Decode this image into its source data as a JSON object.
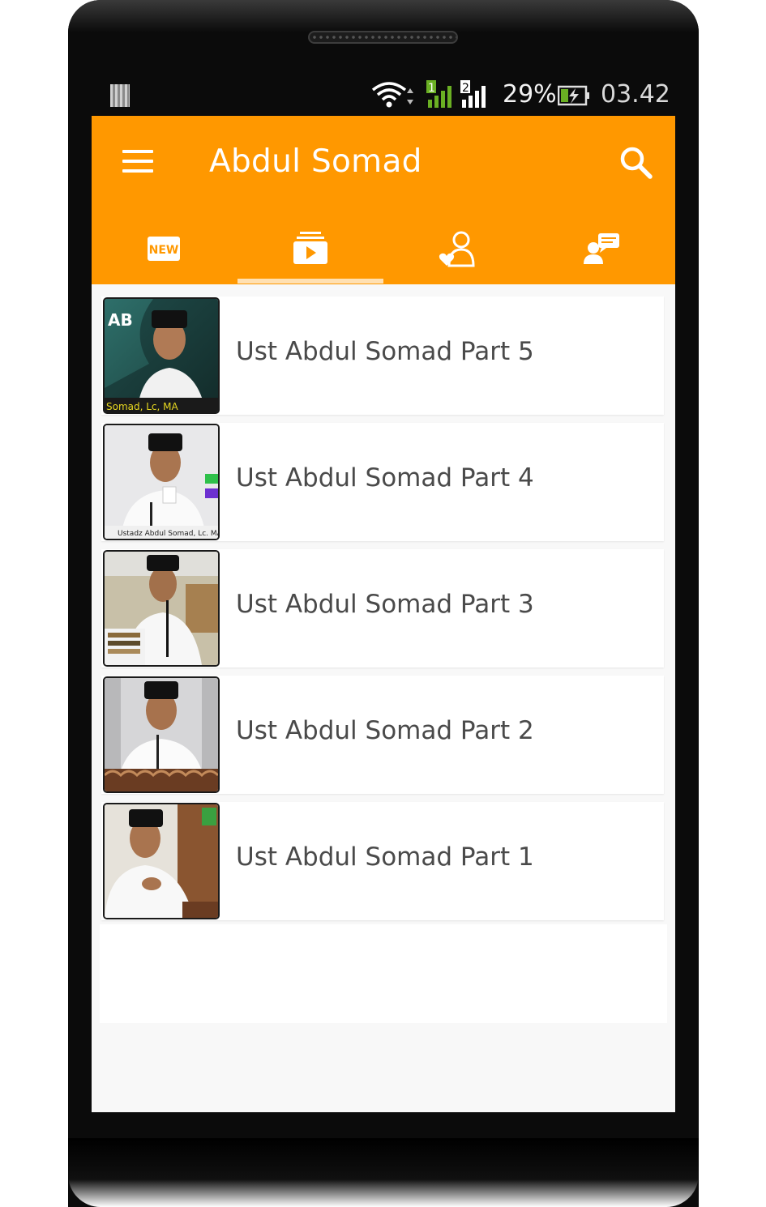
{
  "status_bar": {
    "battery_percent": "29%",
    "time": "03.42",
    "sim1_label": "1",
    "sim2_label": "2",
    "icons": [
      "sd-card-icon",
      "wifi-icon",
      "signal-sim1-icon",
      "signal-sim2-icon",
      "battery-charging-icon"
    ]
  },
  "app_bar": {
    "title": "Abdul Somad",
    "menu_icon": "hamburger-menu-icon",
    "search_icon": "search-icon",
    "background_color": "#ff9800"
  },
  "tabs": [
    {
      "name": "new",
      "icon": "new-badge-icon",
      "label": "NEW",
      "selected": false
    },
    {
      "name": "videos",
      "icon": "video-playlist-icon",
      "selected": true
    },
    {
      "name": "favorites",
      "icon": "user-heart-icon",
      "selected": false
    },
    {
      "name": "chat",
      "icon": "user-chat-icon",
      "selected": false
    }
  ],
  "videos": [
    {
      "title": "Ust Abdul Somad Part 5",
      "thumb_text": "AB",
      "thumb_caption": "Somad, Lc, MA"
    },
    {
      "title": "Ust Abdul Somad Part 4",
      "thumb_text": "",
      "thumb_caption": "Ustadz Abdul Somad, Lc. MA"
    },
    {
      "title": "Ust Abdul Somad Part 3",
      "thumb_text": "",
      "thumb_caption": ""
    },
    {
      "title": "Ust Abdul Somad Part 2",
      "thumb_text": "",
      "thumb_caption": ""
    },
    {
      "title": "Ust Abdul Somad Part 1",
      "thumb_text": "",
      "thumb_caption": ""
    }
  ]
}
